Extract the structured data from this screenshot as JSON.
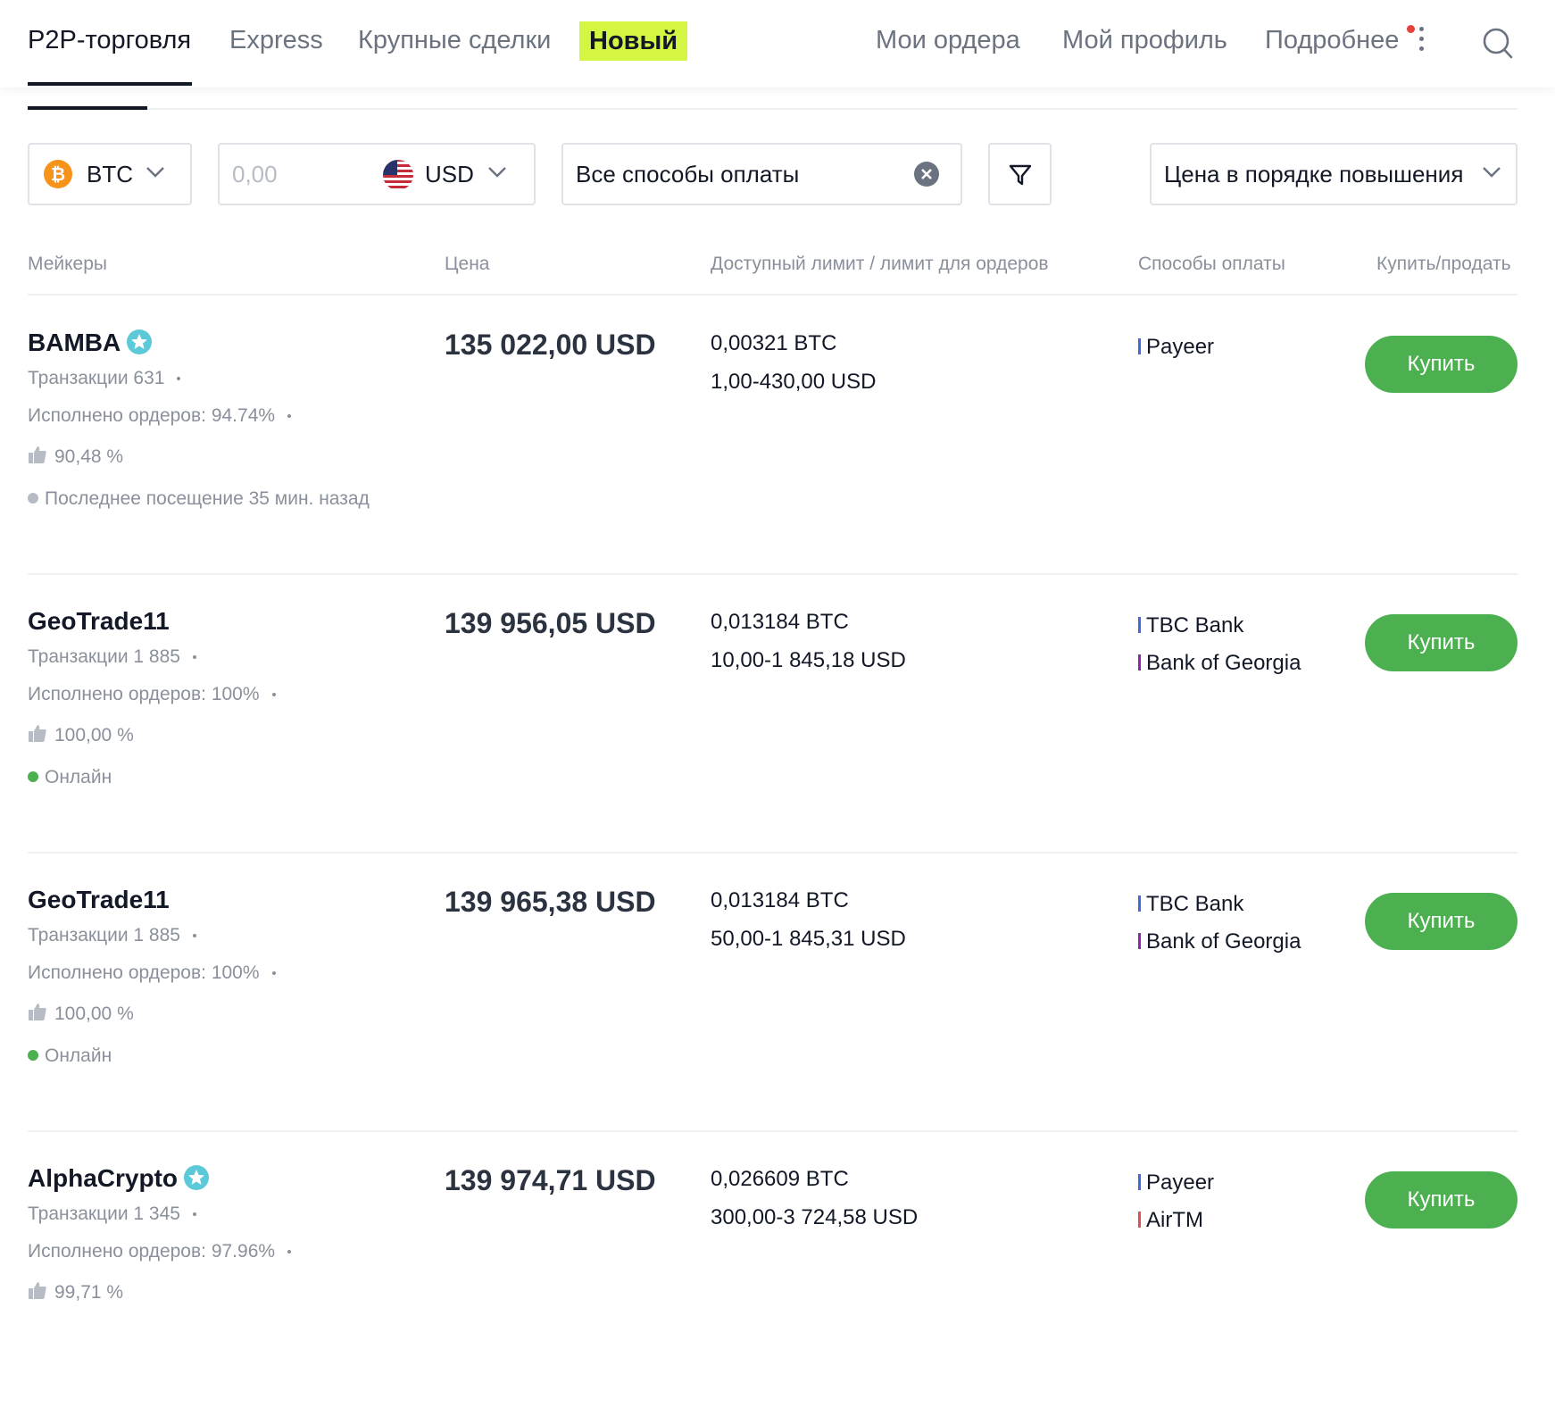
{
  "nav": {
    "tabs": [
      "P2P-торговля",
      "Express",
      "Крупные сделки"
    ],
    "new_label": "Новый",
    "right": [
      "Мои ордера",
      "Мой профиль",
      "Подробнее"
    ]
  },
  "filters": {
    "coin": "BTC",
    "amount_placeholder": "0,00",
    "fiat": "USD",
    "payment": "Все способы оплаты",
    "sort": "Цена в порядке повышения"
  },
  "colors": {
    "accent": "#d4f542",
    "buy": "#4caf50",
    "online": "#4caf50",
    "offline": "#b6bbc4"
  },
  "table": {
    "headers": [
      "Мейкеры",
      "Цена",
      "Доступный лимит / лимит для ордеров",
      "Способы оплаты",
      "Купить/продать"
    ],
    "rows": [
      {
        "maker": "BAMBA",
        "transactions": "Транзакции 631",
        "completed": "Исполнено ордеров: 94.74%",
        "rating": "90,48 %",
        "status": "Последнее посещение 35 мин. назад",
        "price": "135 022,00 USD",
        "available": "0,00321 BTC",
        "limit": "1,00-430,00 USD",
        "payments": [
          "Payeer"
        ],
        "action": "Купить"
      },
      {
        "maker": "GeoTrade11",
        "transactions": "Транзакции 1 885",
        "completed": "Исполнено ордеров: 100%",
        "rating": "100,00 %",
        "status": "Онлайн",
        "price": "139 956,05 USD",
        "available": "0,013184 BTC",
        "limit": "10,00-1 845,18 USD",
        "payments": [
          "TBC Bank",
          "Bank of Georgia"
        ],
        "action": "Купить"
      },
      {
        "maker": "GeoTrade11",
        "transactions": "Транзакции 1 885",
        "completed": "Исполнено ордеров: 100%",
        "rating": "100,00 %",
        "status": "Онлайн",
        "price": "139 965,38 USD",
        "available": "0,013184 BTC",
        "limit": "50,00-1 845,31 USD",
        "payments": [
          "TBC Bank",
          "Bank of Georgia"
        ],
        "action": "Купить"
      },
      {
        "maker": "AlphaCrypto",
        "transactions": "Транзакции 1 345",
        "completed": "Исполнено ордеров: 97.96%",
        "rating": "99,71 %",
        "price": "139 974,71 USD",
        "available": "0,026609 BTC",
        "limit": "300,00-3 724,58 USD",
        "payments": [
          "Payeer",
          "AirTM"
        ],
        "action": "Купить"
      }
    ]
  }
}
